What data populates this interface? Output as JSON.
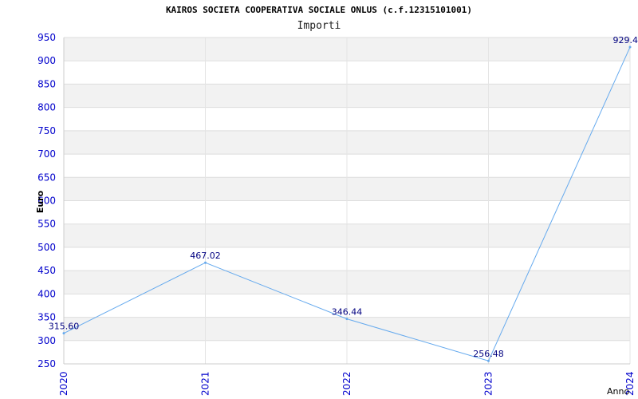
{
  "chart_data": {
    "type": "line",
    "title": "KAIROS SOCIETA COOPERATIVA SOCIALE ONLUS (c.f.12315101001)",
    "subtitle": "Importi",
    "xlabel": "Anno",
    "ylabel": "Euro",
    "categories": [
      "2020",
      "2021",
      "2022",
      "2023",
      "2024"
    ],
    "series": [
      {
        "values": [
          315.6,
          467.02,
          346.44,
          256.48,
          929.4
        ],
        "labels": [
          "315.60",
          "467.02",
          "346.44",
          "256.48",
          "929.4"
        ]
      }
    ],
    "ylim": [
      250,
      950
    ],
    "yticks": [
      "250",
      "300",
      "350",
      "400",
      "450",
      "500",
      "550",
      "600",
      "650",
      "700",
      "750",
      "800",
      "850",
      "900",
      "950"
    ],
    "grid": true,
    "colors": {
      "line": "#66aaee",
      "band": "#f2f2f2",
      "tick": "#0000cc",
      "label": "#000080"
    }
  }
}
